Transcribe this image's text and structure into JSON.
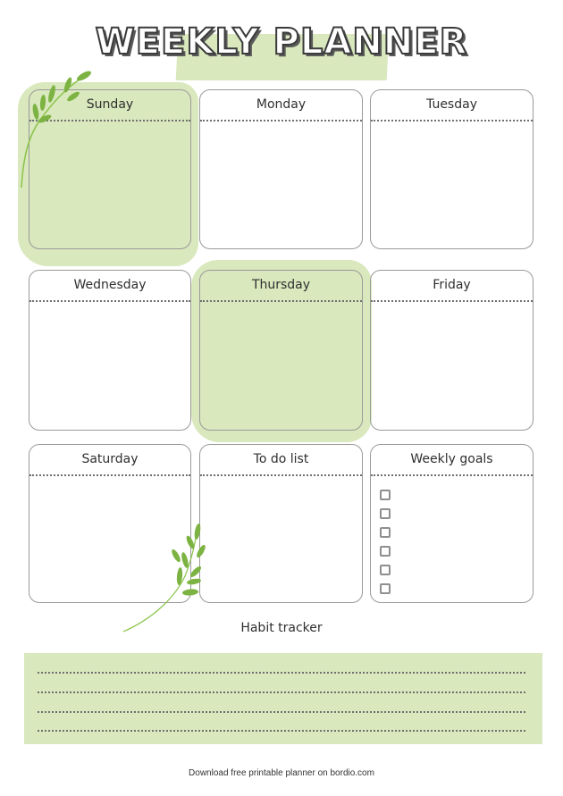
{
  "header": {
    "title": "WEEKLY PLANNER"
  },
  "days": [
    {
      "label": "Sunday",
      "highlighted": true
    },
    {
      "label": "Monday",
      "highlighted": false
    },
    {
      "label": "Tuesday",
      "highlighted": false
    },
    {
      "label": "Wednesday",
      "highlighted": false
    },
    {
      "label": "Thursday",
      "highlighted": true
    },
    {
      "label": "Friday",
      "highlighted": false
    },
    {
      "label": "Saturday",
      "highlighted": false
    }
  ],
  "todo": {
    "label": "To do list"
  },
  "goals": {
    "label": "Weekly goals",
    "checkbox_count": 6
  },
  "habit": {
    "label": "Habit tracker",
    "line_count": 4
  },
  "footer": {
    "text": "Download free printable planner on bordio.com"
  },
  "colors": {
    "accent_green": "#d9e8bd",
    "leaf_green": "#7cb342",
    "border_gray": "#9a9a9a",
    "text_dark": "#2f2f2f"
  }
}
